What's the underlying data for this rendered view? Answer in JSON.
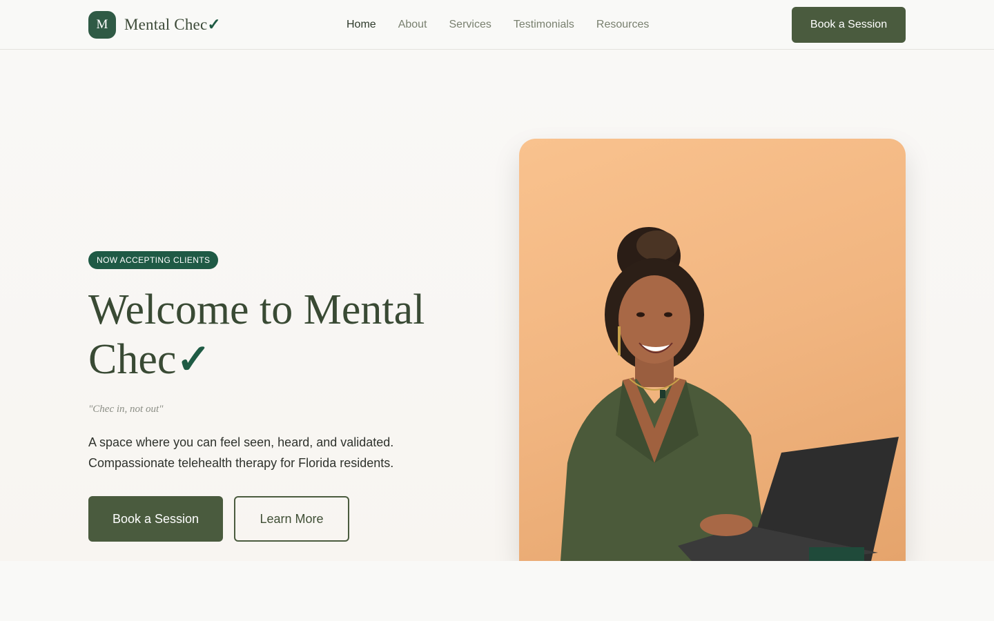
{
  "brand": {
    "mark": "M",
    "name": "Mental Chec",
    "check": "✓"
  },
  "nav": {
    "items": [
      "Home",
      "About",
      "Services",
      "Testimonials",
      "Resources"
    ],
    "active": "Home"
  },
  "header": {
    "cta_label": "Book a Session"
  },
  "hero": {
    "badge": "NOW ACCEPTING CLIENTS",
    "title_line1": "Welcome to Mental",
    "title_line2": "Chec",
    "title_check": "✓",
    "tagline": "\"Chec in, not out\"",
    "description": "A space where you can feel seen, heard, and validated. Compassionate telehealth therapy for Florida residents.",
    "primary_cta": "Book a Session",
    "secondary_cta": "Learn More"
  },
  "photo": {
    "subject": "therapist-portrait-with-laptop"
  },
  "colors": {
    "primary": "#4a5b3e",
    "accent": "#1f5a45",
    "background": "#f9f8f6",
    "photo_bg": "#f3b987"
  }
}
